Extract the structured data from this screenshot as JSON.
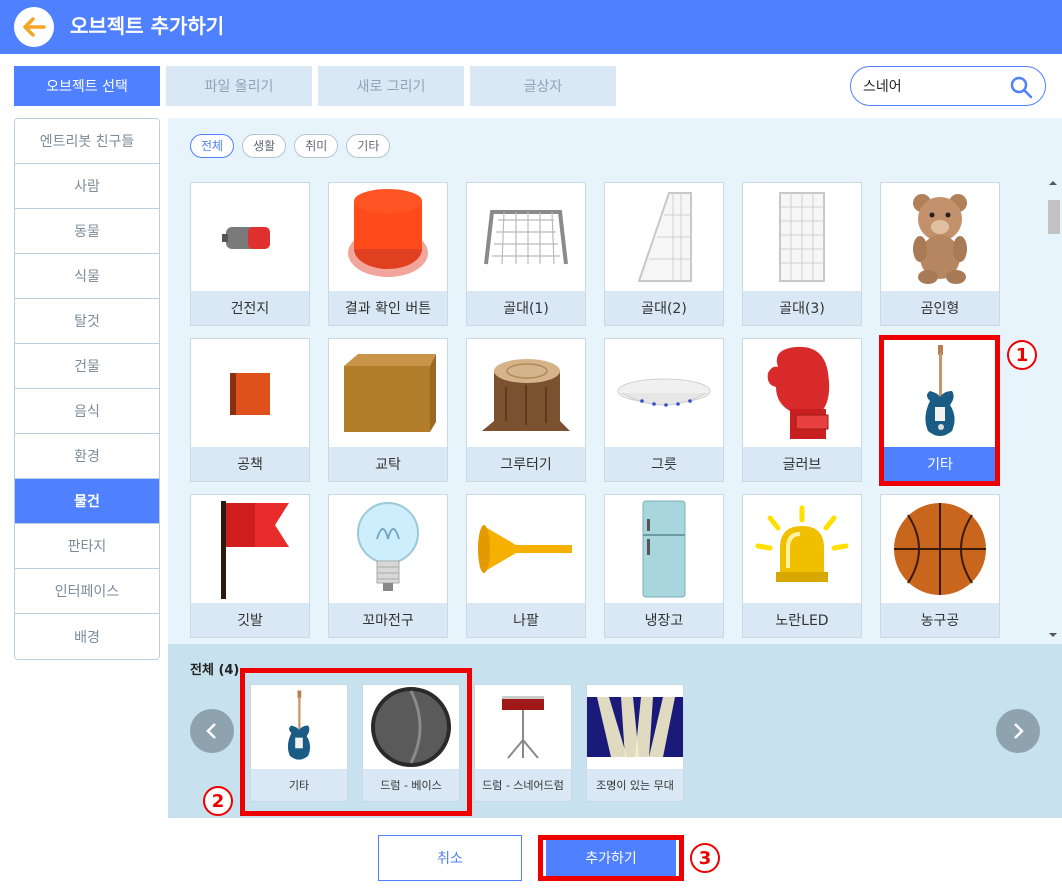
{
  "header": {
    "title": "오브젝트 추가하기"
  },
  "tabs": [
    {
      "label": "오브젝트 선택",
      "active": true
    },
    {
      "label": "파일 올리기",
      "active": false
    },
    {
      "label": "새로 그리기",
      "active": false
    },
    {
      "label": "글상자",
      "active": false
    }
  ],
  "search": {
    "value": "스네어"
  },
  "sidebar": {
    "items": [
      {
        "label": "엔트리봇 친구들"
      },
      {
        "label": "사람"
      },
      {
        "label": "동물"
      },
      {
        "label": "식물"
      },
      {
        "label": "탈것"
      },
      {
        "label": "건물"
      },
      {
        "label": "음식"
      },
      {
        "label": "환경"
      },
      {
        "label": "물건",
        "active": true
      },
      {
        "label": "판타지"
      },
      {
        "label": "인터페이스"
      },
      {
        "label": "배경"
      }
    ]
  },
  "filters": [
    {
      "label": "전체",
      "active": true
    },
    {
      "label": "생활"
    },
    {
      "label": "취미"
    },
    {
      "label": "기타"
    }
  ],
  "objects": [
    {
      "label": "건전지"
    },
    {
      "label": "결과 확인 버튼"
    },
    {
      "label": "골대(1)"
    },
    {
      "label": "골대(2)"
    },
    {
      "label": "골대(3)"
    },
    {
      "label": "곰인형"
    },
    {
      "label": "공책"
    },
    {
      "label": "교탁"
    },
    {
      "label": "그루터기"
    },
    {
      "label": "그릇"
    },
    {
      "label": "글러브"
    },
    {
      "label": "기타",
      "selected": true
    },
    {
      "label": "깃발"
    },
    {
      "label": "꼬마전구"
    },
    {
      "label": "나팔"
    },
    {
      "label": "냉장고"
    },
    {
      "label": "노란LED"
    },
    {
      "label": "농구공"
    }
  ],
  "selection": {
    "title": "전체 (4)",
    "items": [
      {
        "label": "기타"
      },
      {
        "label": "드럼 - 베이스"
      },
      {
        "label": "드럼 - 스네어드럼"
      },
      {
        "label": "조명이 있는 무대"
      }
    ]
  },
  "annotations": {
    "n1": "1",
    "n2": "2",
    "n3": "3"
  },
  "buttons": {
    "cancel": "취소",
    "add": "추가하기"
  },
  "colors": {
    "accent": "#4f80ff",
    "highlight": "#ee0000"
  }
}
